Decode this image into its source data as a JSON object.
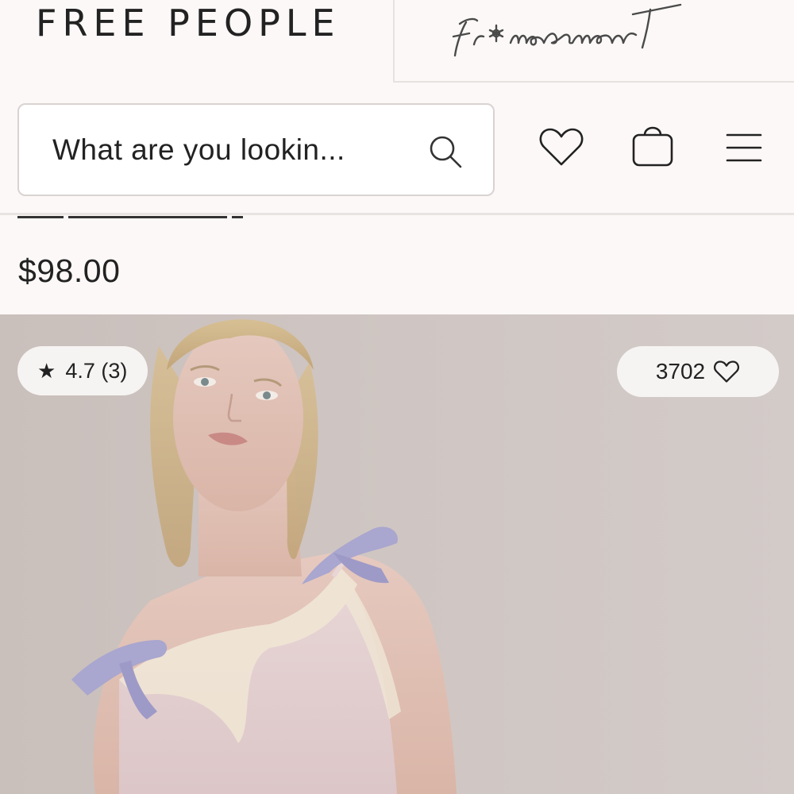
{
  "brand": {
    "primary": "FREE PEOPLE",
    "secondary": "fp movement"
  },
  "search": {
    "placeholder": "What are you lookin..."
  },
  "icons": {
    "search": "search-icon",
    "wishlist": "heart-icon",
    "bag": "shopping-bag-icon",
    "menu": "hamburger-menu-icon",
    "rating": "star-icon",
    "likes": "heart-icon"
  },
  "product": {
    "price": "$98.00",
    "rating_label": "4.7 (3)",
    "likes_count": "3702"
  },
  "colors": {
    "background": "#fcf8f7",
    "text": "#222222",
    "pill": "#f6f4f3",
    "ribbon": "#a9a6cf"
  }
}
